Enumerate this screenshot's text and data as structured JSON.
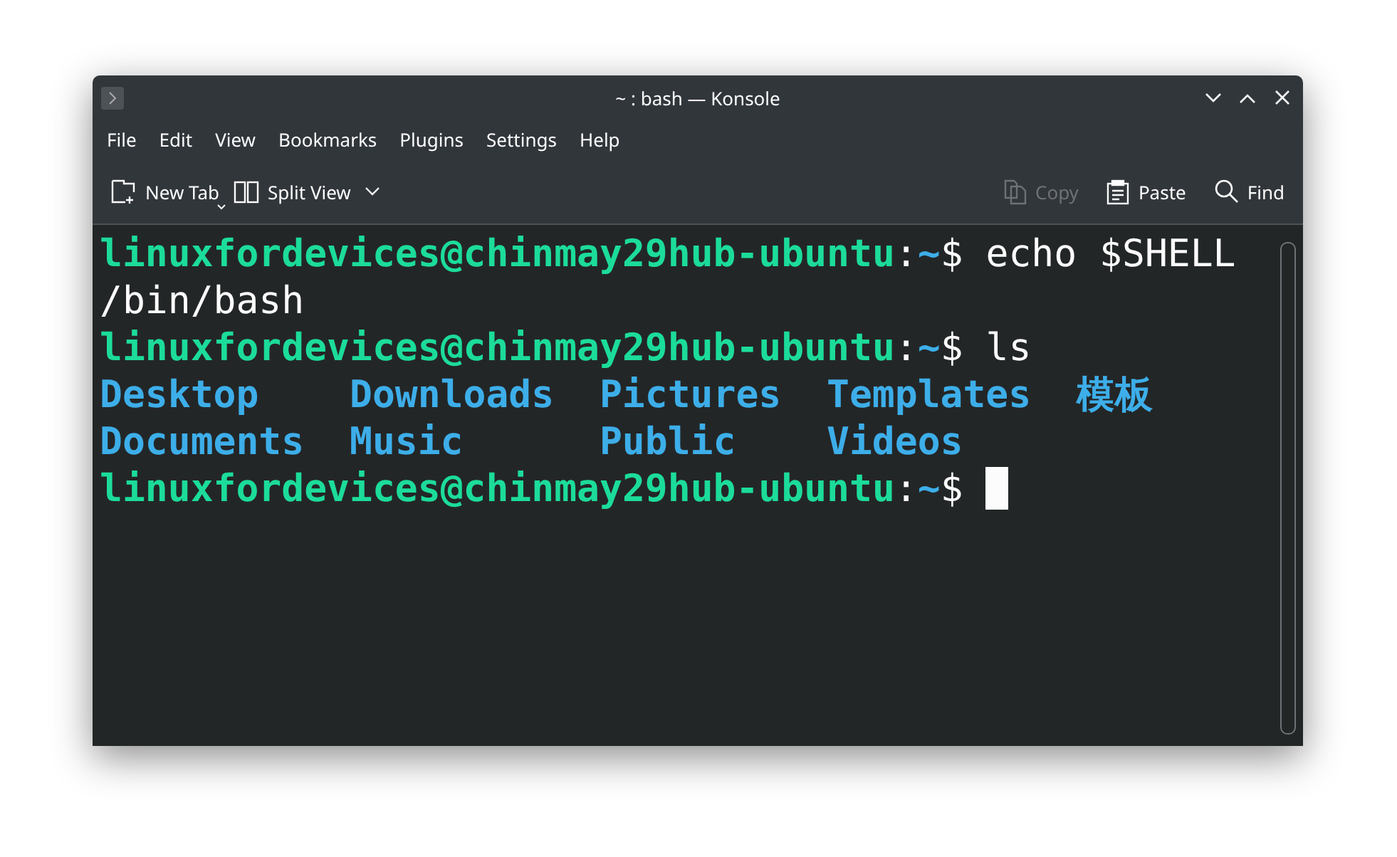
{
  "window": {
    "title": "~ : bash — Konsole"
  },
  "menu": [
    "File",
    "Edit",
    "View",
    "Bookmarks",
    "Plugins",
    "Settings",
    "Help"
  ],
  "toolbar": [
    {
      "kind": "new-tab",
      "label": "New Tab",
      "disabled": false
    },
    {
      "kind": "split-view",
      "label": "Split View",
      "disabled": false
    },
    {
      "kind": "copy",
      "label": "Copy",
      "disabled": true
    },
    {
      "kind": "paste",
      "label": "Paste",
      "disabled": false
    },
    {
      "kind": "find",
      "label": "Find",
      "disabled": false
    }
  ],
  "terminal": {
    "lines": [
      {
        "kind": "prompt",
        "user_host": "linuxfordevices@chinmay29hub-ubuntu",
        "separator": ":",
        "path": "~",
        "symbol": "$",
        "command": "echo $SHELL",
        "cursor": false
      },
      {
        "kind": "output",
        "text": "/bin/bash"
      },
      {
        "kind": "prompt",
        "user_host": "linuxfordevices@chinmay29hub-ubuntu",
        "separator": ":",
        "path": "~",
        "symbol": "$",
        "command": "ls",
        "cursor": false
      },
      {
        "kind": "listing",
        "items": [
          "Desktop",
          "Downloads",
          "Pictures",
          "Templates",
          "模板"
        ]
      },
      {
        "kind": "listing",
        "items": [
          "Documents",
          "Music",
          "Public",
          "Videos"
        ]
      },
      {
        "kind": "prompt",
        "user_host": "linuxfordevices@chinmay29hub-ubuntu",
        "separator": ":",
        "path": "~",
        "symbol": "$",
        "cursor": true
      }
    ]
  }
}
